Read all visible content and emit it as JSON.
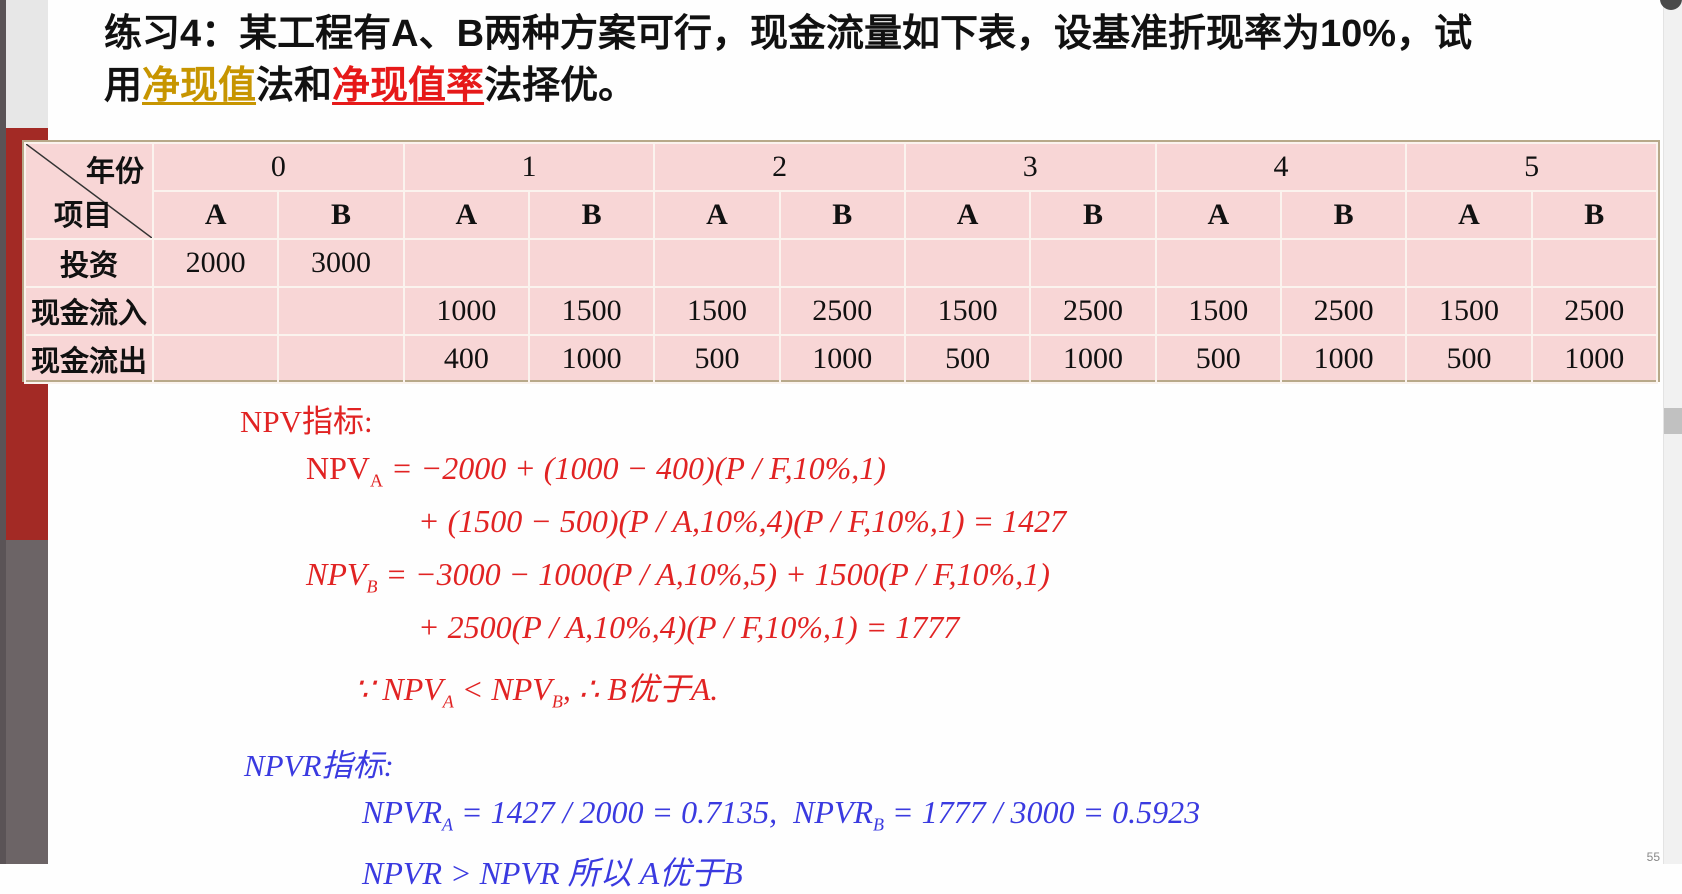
{
  "title": {
    "prefix": "练习4：某工程有A、B两种方案可行，现金流量如下表，设基准折现率为10%，试",
    "line2_start": "用",
    "highlight1": "净现值",
    "mid": "法和",
    "highlight2": "净现值率",
    "end": "法择优。"
  },
  "table": {
    "corner_top": "年份",
    "corner_bottom": "项目",
    "years": [
      "0",
      "1",
      "2",
      "3",
      "4",
      "5"
    ],
    "sub_headers": [
      "A",
      "B",
      "A",
      "B",
      "A",
      "B",
      "A",
      "B",
      "A",
      "B",
      "A",
      "B"
    ],
    "rows": [
      {
        "label": "投资",
        "values": [
          "2000",
          "3000",
          "",
          "",
          "",
          "",
          "",
          "",
          "",
          "",
          "",
          ""
        ]
      },
      {
        "label": "现金流入",
        "values": [
          "",
          "",
          "1000",
          "1500",
          "1500",
          "2500",
          "1500",
          "2500",
          "1500",
          "2500",
          "1500",
          "2500"
        ]
      },
      {
        "label": "现金流出",
        "values": [
          "",
          "",
          "400",
          "1000",
          "500",
          "1000",
          "500",
          "1000",
          "500",
          "1000",
          "500",
          "1000"
        ]
      }
    ]
  },
  "npv": {
    "heading": "NPV指标:",
    "line_a1": "NPV",
    "sub_a": "A",
    "expr_a1": " = −2000 + (1000 − 400)(P / F,10%,1)",
    "expr_a2": "+ (1500 − 500)(P / A,10%,4)(P / F,10%,1) = 1427",
    "line_b1": "NPV",
    "sub_b": "B",
    "expr_b1": " = −3000 − 1000(P / A,10%,5) + 1500(P / F,10%,1)",
    "expr_b2": "+ 2500(P / A,10%,4)(P / F,10%,1) = 1777",
    "conclusion": "∵ NPV",
    "conclusion_sub_a": "A",
    "conclusion_mid": " < NPV",
    "conclusion_sub_b": "B",
    "conclusion_end": ", ∴ B优于A."
  },
  "npvr": {
    "heading": "NPVR指标:",
    "a_label": "NPVR",
    "a_sub": "A",
    "a_expr": " = 1427 / 2000 = 0.7135,",
    "b_label": "NPVR",
    "b_sub": "B",
    "b_expr": " = 1777 / 3000 = 0.5923",
    "partial_line": "NPVR  >  NPVR   所以 A优于B"
  },
  "page_number": "55"
}
